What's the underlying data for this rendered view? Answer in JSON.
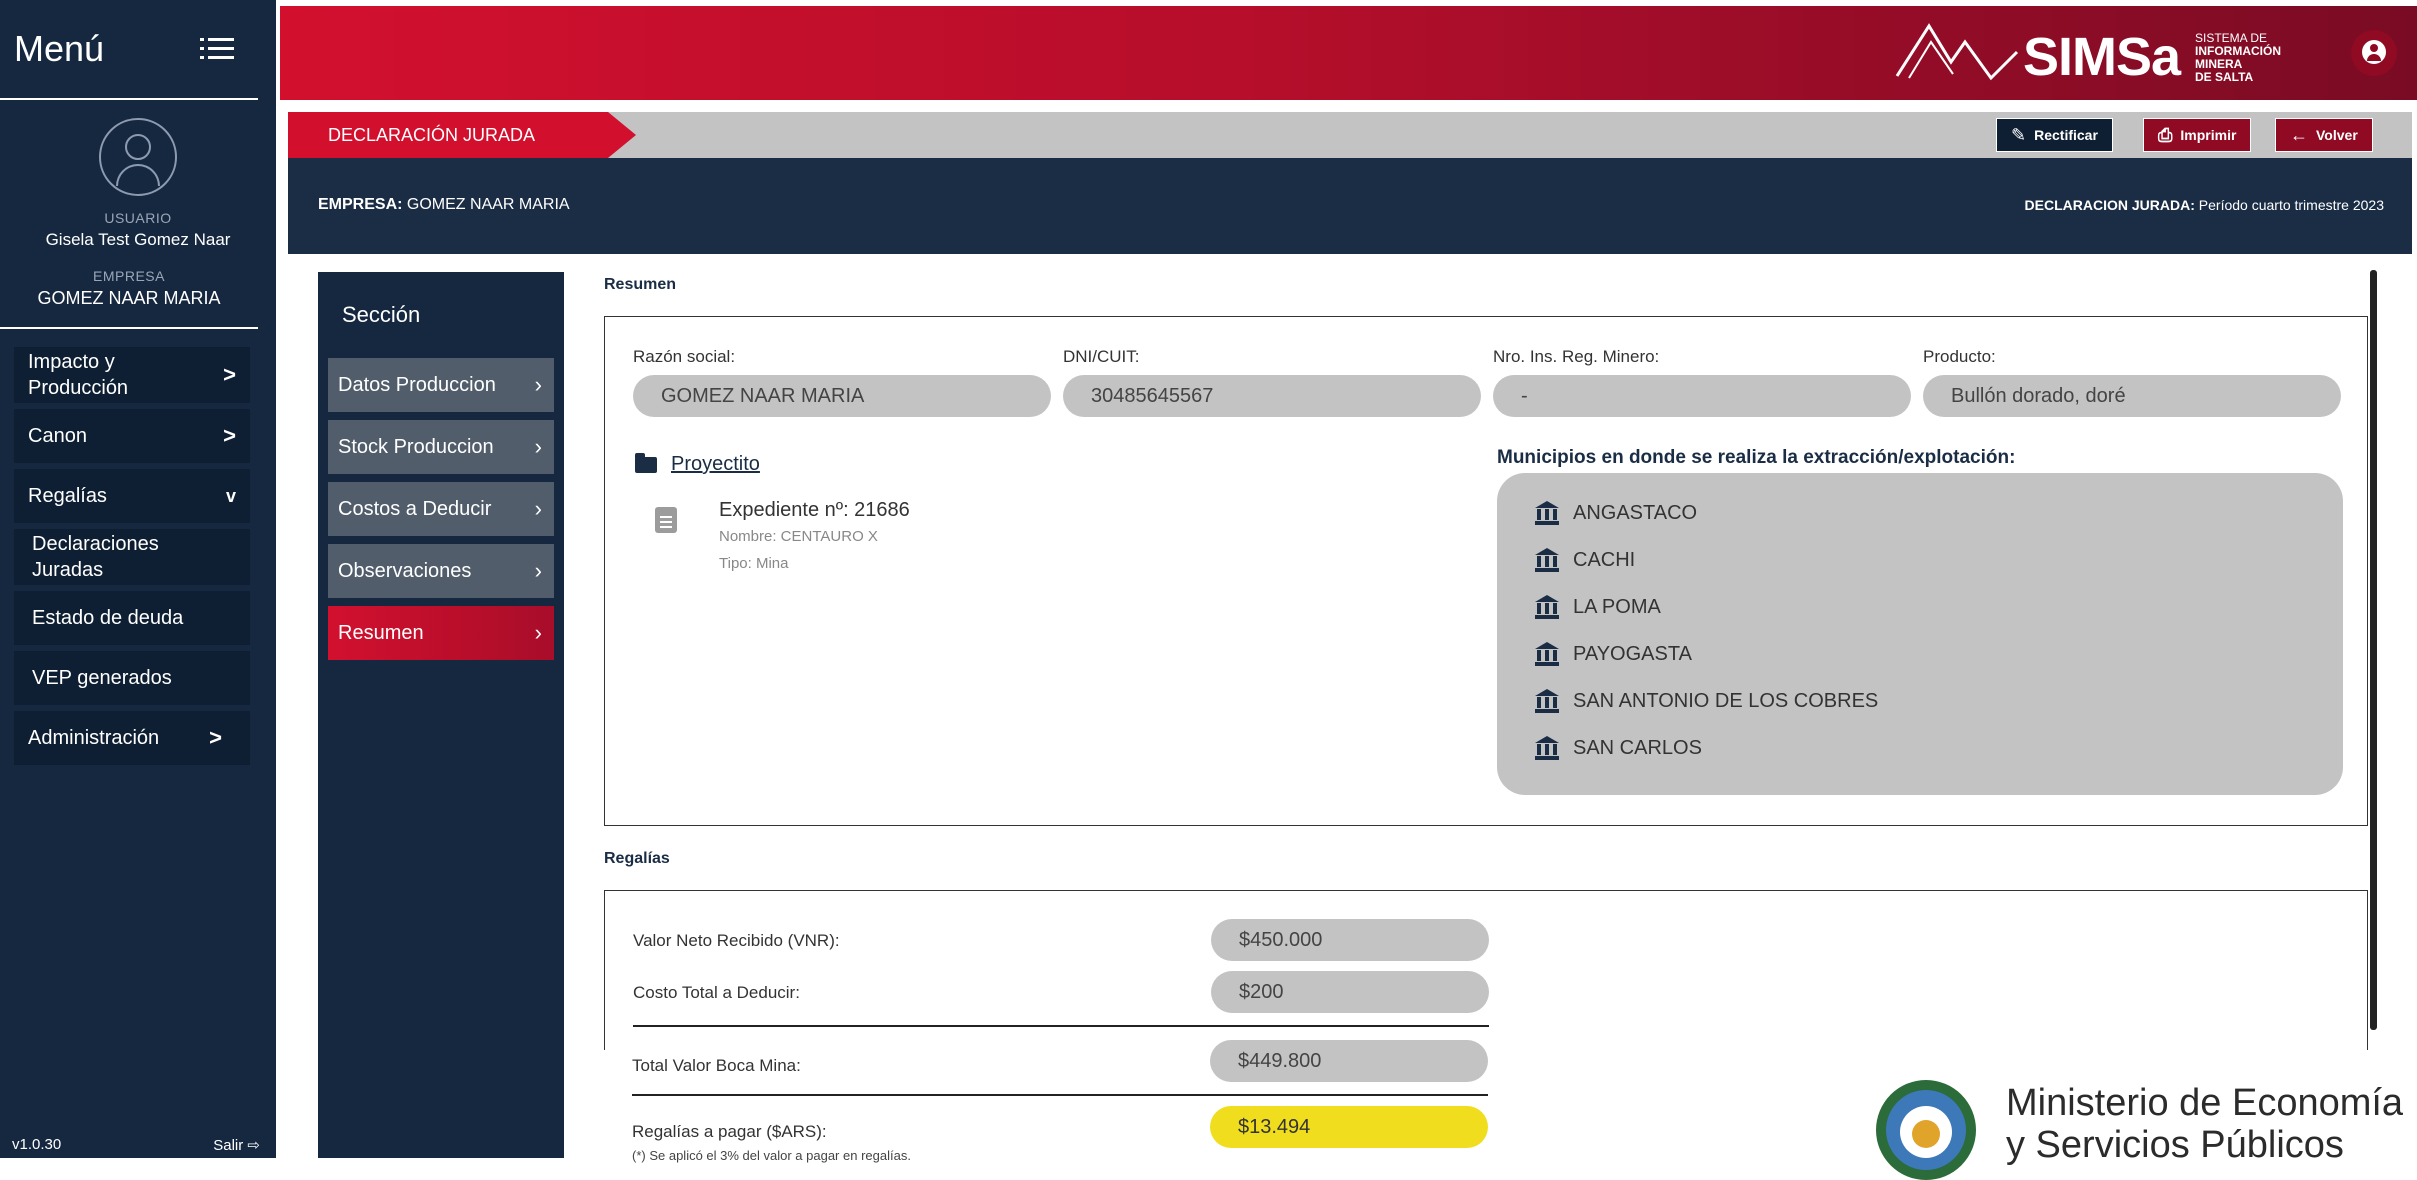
{
  "sidebar": {
    "title": "Menú",
    "user_label": "USUARIO",
    "user_name": "Gisela Test Gomez Naar",
    "company_label": "EMPRESA",
    "company_name": "GOMEZ NAAR MARIA",
    "items": [
      {
        "label": "Impacto y Producción",
        "chevron": ">"
      },
      {
        "label": "Canon",
        "chevron": ">"
      },
      {
        "label": "Regalías",
        "chevron": "v"
      },
      {
        "label": "Declaraciones Juradas"
      },
      {
        "label": "Estado de deuda"
      },
      {
        "label": "VEP generados"
      },
      {
        "label": "Administración",
        "chevron": ">"
      }
    ],
    "version": "v1.0.30",
    "logout": "Salir ⇨"
  },
  "topbar": {
    "brand": "SIMSa",
    "brand_sub": [
      "SISTEMA DE",
      "INFORMACIÓN MINERA",
      "DE SALTA"
    ],
    "accent": "#d2102e"
  },
  "declaration": {
    "tab": "DECLARACIÓN JURADA",
    "buttons": {
      "rectify": "Rectificar",
      "print": "Imprimir",
      "back": "Volver"
    },
    "company_label": "EMPRESA:",
    "company_value": "GOMEZ NAAR MARIA",
    "period_label": "DECLARACION JURADA:",
    "period_value": "Período cuarto trimestre 2023"
  },
  "sections": {
    "title": "Sección",
    "items": [
      "Datos Produccion",
      "Stock Produccion",
      "Costos a Deducir",
      "Observaciones",
      "Resumen"
    ],
    "active": "Resumen"
  },
  "summary": {
    "heading": "Resumen",
    "fields": [
      {
        "label": "Razón social:",
        "value": "GOMEZ NAAR MARIA"
      },
      {
        "label": "DNI/CUIT:",
        "value": "30485645567"
      },
      {
        "label": "Nro. Ins. Reg. Minero:",
        "value": "-"
      },
      {
        "label": "Producto:",
        "value": "Bullón dorado, doré"
      }
    ],
    "project_name": "Proyectito",
    "expediente": "Expediente nº: 21686",
    "nombre": "Nombre: CENTAURO X",
    "tipo": "Tipo: Mina",
    "municipios_title": "Municipios en donde se realiza la extracción/explotación:",
    "municipios": [
      "ANGASTACO",
      "CACHI",
      "LA POMA",
      "PAYOGASTA",
      "SAN ANTONIO DE LOS COBRES",
      "SAN CARLOS"
    ]
  },
  "regalias": {
    "heading": "Regalías",
    "rows": [
      {
        "label": "Valor Neto Recibido (VNR):",
        "value": "$450.000"
      },
      {
        "label": "Costo Total a Deducir:",
        "value": "$200"
      },
      {
        "label": "Total Valor Boca Mina:",
        "value": "$449.800"
      },
      {
        "label": "Regalías a pagar ($ARS):",
        "value": "$13.494"
      }
    ],
    "footnote": "(*) Se aplicó el 3% del valor a pagar en regalías."
  },
  "ministry": {
    "line1": "Ministerio de Economía",
    "line2": "y Servicios Públicos"
  }
}
